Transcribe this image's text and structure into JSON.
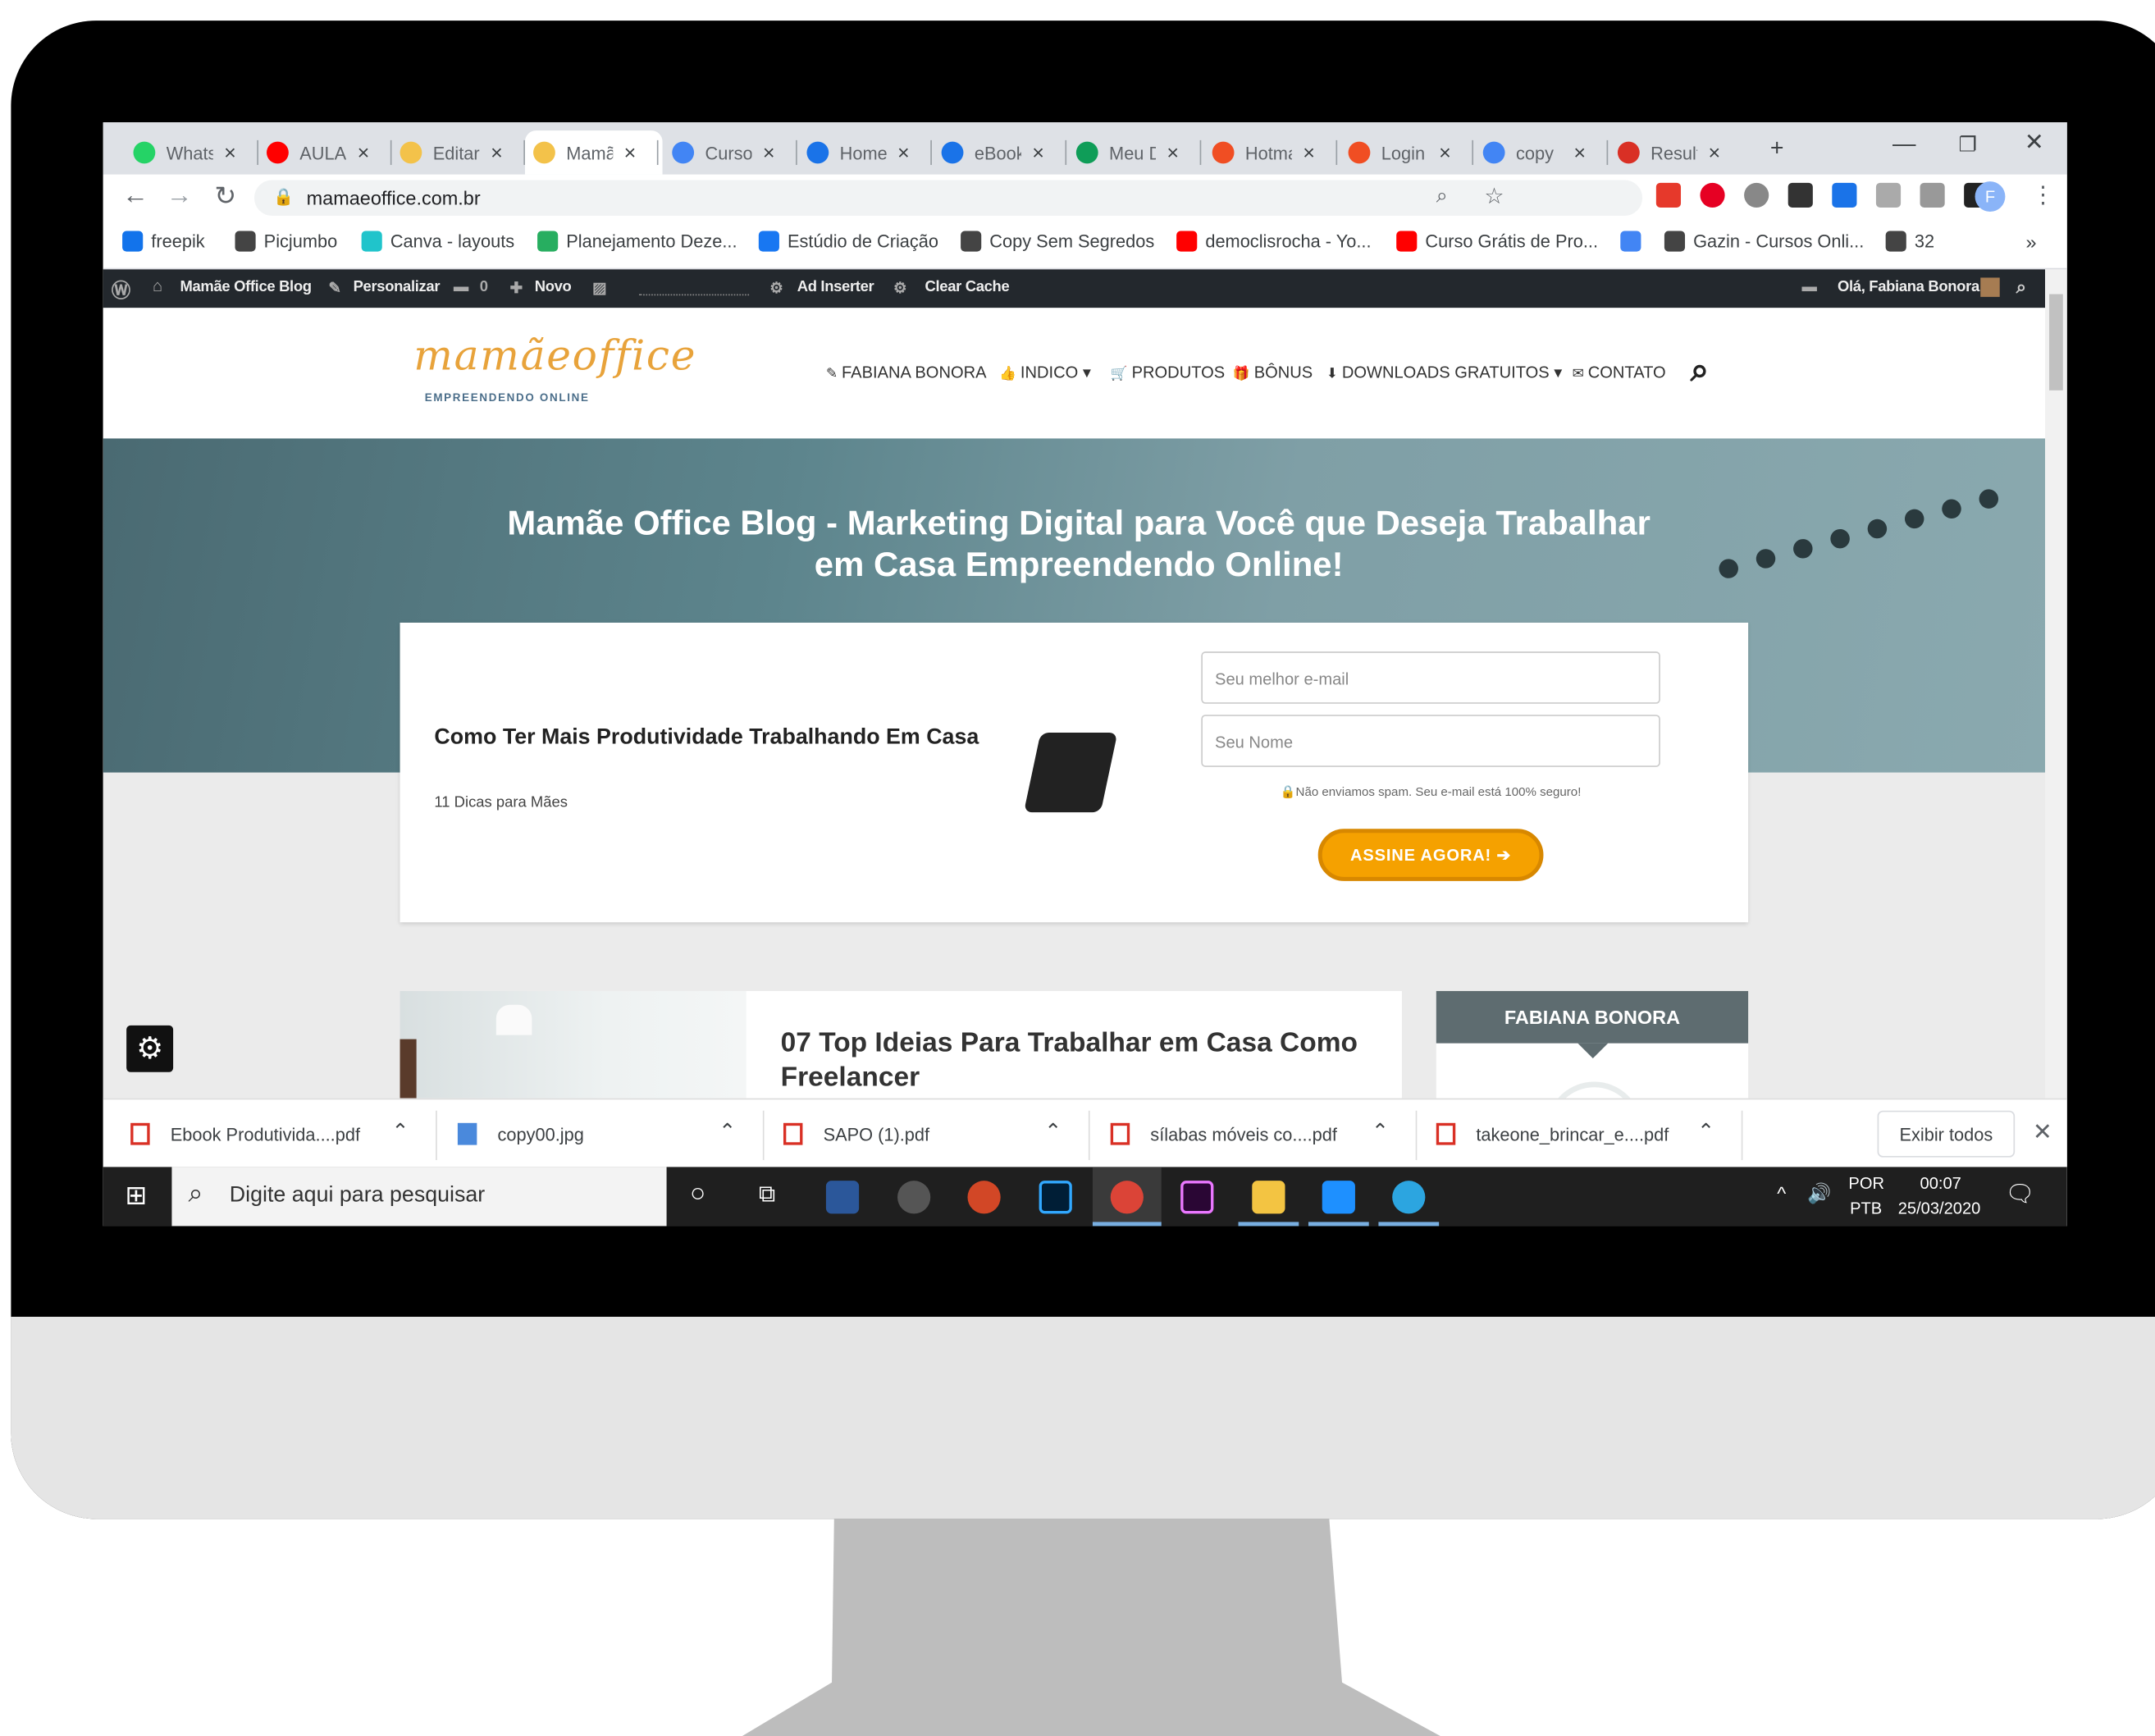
{
  "browser": {
    "tabs": [
      {
        "label": "WhatsApp",
        "color": "#25d366"
      },
      {
        "label": "AULA",
        "color": "#ff0000"
      },
      {
        "label": "Editar",
        "color": "#f3c24a"
      },
      {
        "label": "Mamãe Office",
        "color": "#f3c24a",
        "active": true
      },
      {
        "label": "Curso",
        "color": "#4285f4"
      },
      {
        "label": "Home",
        "color": "#1a73e8"
      },
      {
        "label": "eBook",
        "color": "#1a73e8"
      },
      {
        "label": "Meu Drive",
        "color": "#0f9d58"
      },
      {
        "label": "Hotmart",
        "color": "#f04e23"
      },
      {
        "label": "Login",
        "color": "#f04e23"
      },
      {
        "label": "copy",
        "color": "#4285f4"
      },
      {
        "label": "Resultado",
        "color": "#d93025"
      }
    ],
    "new_tab": "+",
    "close_glyph": "×",
    "url": "mamaeoffice.com.br",
    "bookmarks": [
      {
        "label": "freepik",
        "color": "#1273eb"
      },
      {
        "label": "Picjumbo",
        "color": "#444444"
      },
      {
        "label": "Canva - layouts",
        "color": "#20c4cb"
      },
      {
        "label": "Planejamento Deze...",
        "color": "#27ae60"
      },
      {
        "label": "Estúdio de Criação",
        "color": "#1877f2"
      },
      {
        "label": "Copy Sem Segredos",
        "color": "#444444"
      },
      {
        "label": "democlisrocha - Yo...",
        "color": "#ff0000"
      },
      {
        "label": "Curso Grátis de Pro...",
        "color": "#ff0000"
      },
      {
        "label": "",
        "color": "#4285f4"
      },
      {
        "label": "Gazin - Cursos Onli...",
        "color": "#444444"
      },
      {
        "label": "32",
        "color": "#444444"
      }
    ],
    "more": "»",
    "profile_initial": "F"
  },
  "wp_admin": {
    "site": "Mamãe Office Blog",
    "customize": "Personalizar",
    "comments": "0",
    "new": "Novo",
    "ad_inserter": "Ad Inserter",
    "clear_cache": "Clear Cache",
    "greeting": "Olá, Fabiana Bonora"
  },
  "site": {
    "logo": "mamãeoffice",
    "logo_sub": "EMPREENDENDO ONLINE",
    "nav": [
      {
        "icon": "pencil-icon",
        "label": "FABIANA BONORA"
      },
      {
        "icon": "thumb-icon",
        "label": "INDICO ▾"
      },
      {
        "icon": "cart-icon",
        "label": "PRODUTOS"
      },
      {
        "icon": "gift-icon",
        "label": "BÔNUS"
      },
      {
        "icon": "download-icon",
        "label": "DOWNLOADS GRATUITOS ▾"
      },
      {
        "icon": "mail-icon",
        "label": "CONTATO"
      }
    ],
    "hero_title": "Mamãe Office Blog - Marketing Digital para Você que Deseja Trabalhar em Casa Empreendendo Online!",
    "optin": {
      "title": "Como Ter Mais Produtividade Trabalhando Em Casa",
      "subtitle": "11 Dicas para Mães",
      "email_placeholder": "Seu melhor e-mail",
      "name_placeholder": "Seu Nome",
      "privacy": "Não enviamos spam. Seu e-mail está 100% seguro!",
      "cta": "ASSINE AGORA! ➔",
      "accent": "#f5a100"
    },
    "post_title": "07 Top Ideias Para Trabalhar em Casa Como Freelancer",
    "sidebar_title": "FABIANA BONORA"
  },
  "downloads": {
    "items": [
      {
        "name": "Ebook Produtivida....pdf",
        "type": "pdf"
      },
      {
        "name": "copy00.jpg",
        "type": "image"
      },
      {
        "name": "SAPO (1).pdf",
        "type": "pdf"
      },
      {
        "name": "sílabas móveis co....pdf",
        "type": "pdf"
      },
      {
        "name": "takeone_brincar_e....pdf",
        "type": "pdf"
      }
    ],
    "show_all": "Exibir todos"
  },
  "taskbar": {
    "search_placeholder": "Digite aqui para pesquisar",
    "language": "POR",
    "layout": "PTB",
    "time": "00:07",
    "date": "25/03/2020"
  }
}
